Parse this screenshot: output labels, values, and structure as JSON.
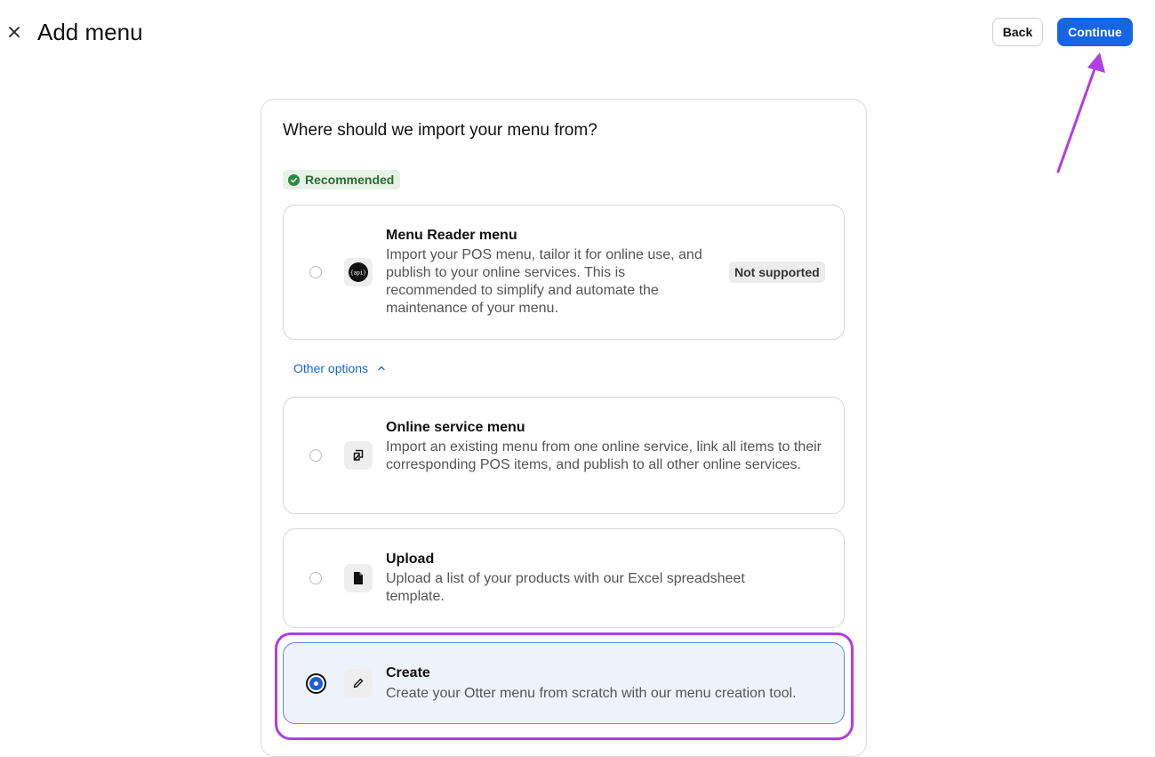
{
  "header": {
    "title": "Add menu",
    "back_label": "Back",
    "continue_label": "Continue"
  },
  "main": {
    "question": "Where should we import your menu from?",
    "recommended_label": "Recommended",
    "other_options_label": "Other options",
    "options": [
      {
        "title": "Menu Reader menu",
        "description": "Import your POS menu, tailor it for online use, and publish to your online services. This is recommended to simplify and automate the maintenance of your menu.",
        "badge": "Not supported",
        "icon_text": "{api}",
        "icon": "api-logo-icon",
        "selected": false
      },
      {
        "title": "Online service menu",
        "description": "Import an existing menu from one online service, link all items to their corresponding POS items, and publish to all other online services.",
        "icon": "link-import-icon",
        "selected": false
      },
      {
        "title": "Upload",
        "description": "Upload a list of your products with our Excel spreadsheet template.",
        "icon": "file-icon",
        "selected": false
      },
      {
        "title": "Create",
        "description": "Create your Otter menu from scratch with our menu creation tool.",
        "icon": "pencil-icon",
        "selected": true
      }
    ]
  },
  "colors": {
    "accent": "#1565e4",
    "annotation": "#b03ee0",
    "recommended_bg": "#e4f3e6",
    "selected_bg": "#eef2fb"
  }
}
